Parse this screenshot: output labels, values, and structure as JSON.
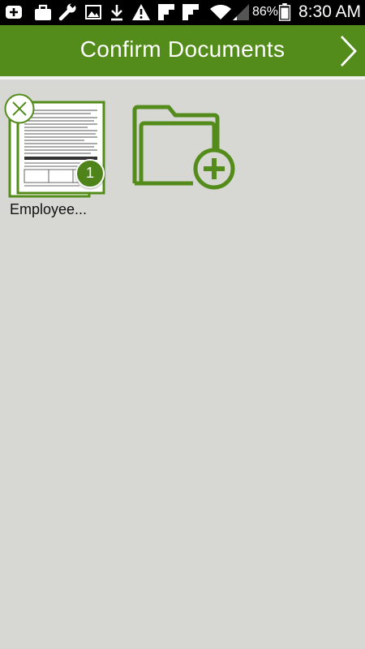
{
  "status_bar": {
    "battery_percent": "86%",
    "time": "8:30 AM",
    "icons": [
      "add-box-icon",
      "briefcase-icon",
      "wrench-icon",
      "image-icon",
      "download-icon",
      "warning-icon",
      "flipboard-icon",
      "flipboard-icon",
      "wifi-icon",
      "signal-icon",
      "battery-icon"
    ]
  },
  "app_bar": {
    "title": "Confirm Documents",
    "next_icon": "chevron-right-icon"
  },
  "documents": [
    {
      "label": "Employee...",
      "page_count": "1",
      "remove_icon": "close-circle-icon"
    }
  ],
  "add_folder": {
    "icon": "folder-add-icon"
  },
  "colors": {
    "primary": "#548c1c",
    "background": "#d7d7d3",
    "status_bar": "#000000"
  }
}
